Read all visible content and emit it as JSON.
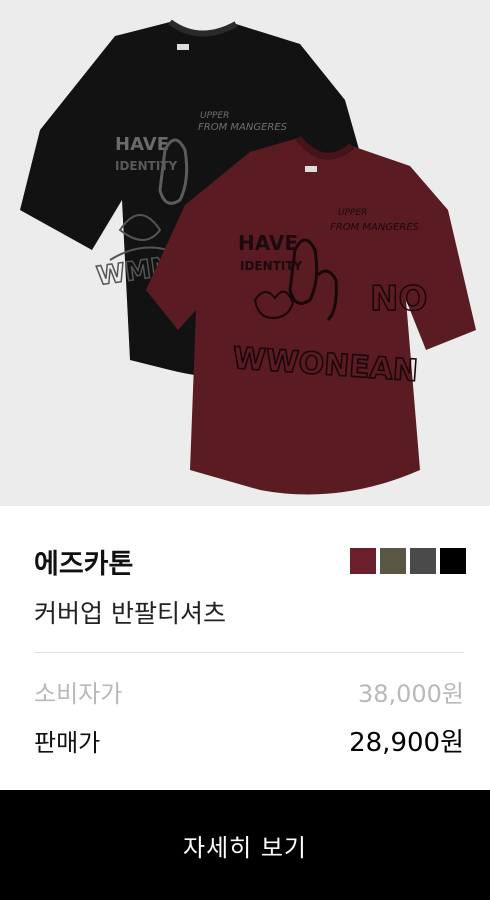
{
  "product": {
    "image_alt": "black and burgundy graphic t-shirts",
    "brand": "에즈카톤",
    "name": "커버업 반팔티셔츠",
    "colors": [
      "#6b1f2b",
      "#5a5644",
      "#4a4a4a",
      "#000000"
    ]
  },
  "prices": {
    "retail_label": "소비자가",
    "retail_value": "38,000원",
    "sale_label": "판매가",
    "sale_value": "28,900원"
  },
  "action": {
    "detail_label": "자세히 보기"
  }
}
